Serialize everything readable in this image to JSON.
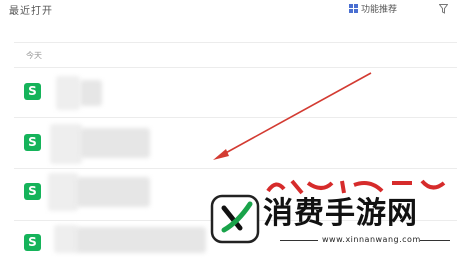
{
  "header": {
    "title": "最近打开",
    "feature_sort_label": "功能推荐"
  },
  "section": {
    "today_label": "今天"
  },
  "files": [
    {
      "icon_glyph": "S",
      "icon_name": "spreadsheet-file-icon"
    },
    {
      "icon_glyph": "S",
      "icon_name": "spreadsheet-file-icon"
    },
    {
      "icon_glyph": "S",
      "icon_name": "spreadsheet-file-icon"
    },
    {
      "icon_glyph": "S",
      "icon_name": "spreadsheet-file-icon"
    }
  ],
  "watermark": {
    "text": "消费手游网",
    "url": "www.xinnanwang.com"
  },
  "colors": {
    "file_icon": "#15b35a",
    "accent_icon": "#4a6fd1",
    "arrow": "#d33b32",
    "watermark_green": "#19a34a",
    "watermark_red": "#d62b2b"
  }
}
